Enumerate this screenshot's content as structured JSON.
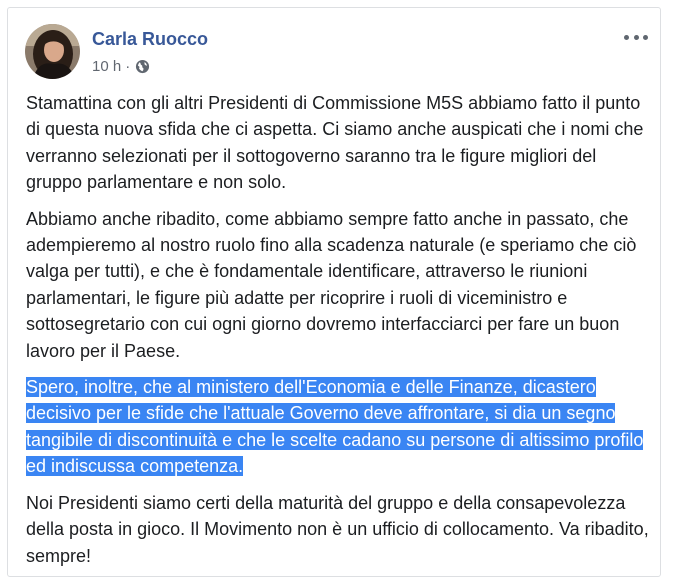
{
  "post": {
    "author": "Carla Ruocco",
    "time": "10 h",
    "separator": "·",
    "privacy_icon": "globe-icon",
    "more_icon": "more-options-icon",
    "paragraphs": [
      "Stamattina con gli altri Presidenti di Commissione M5S abbiamo fatto il punto di questa nuova sfida che ci aspetta. Ci siamo anche auspicati che i nomi che verranno selezionati per il sottogoverno saranno tra le figure migliori del gruppo parlamentare e non solo.",
      "Abbiamo anche ribadito, come abbiamo sempre fatto anche in passato, che adempieremo al nostro ruolo fino alla scadenza naturale (e speriamo che ciò valga per tutti), e che è fondamentale identificare, attraverso le riunioni parlamentari, le figure più adatte per ricoprire i ruoli di viceministro e sottosegretario con cui ogni giorno dovremo interfacciarci per fare un buon lavoro per il Paese.",
      "Spero, inoltre, che al ministero dell'Economia e delle Finanze, dicastero decisivo per le sfide che l'attuale Governo deve affrontare, si dia un segno tangibile di discontinuità e che le scelte cadano su persone di altissimo profilo ed indiscussa competenza.",
      "Noi Presidenti siamo certi della maturità del gruppo e della consapevolezza della posta in gioco. Il Movimento non è un ufficio di collocamento. Va ribadito, sempre!"
    ]
  },
  "colors": {
    "author_link": "#385898",
    "meta_text": "#616770",
    "selection_highlight": "#3a85f3"
  }
}
